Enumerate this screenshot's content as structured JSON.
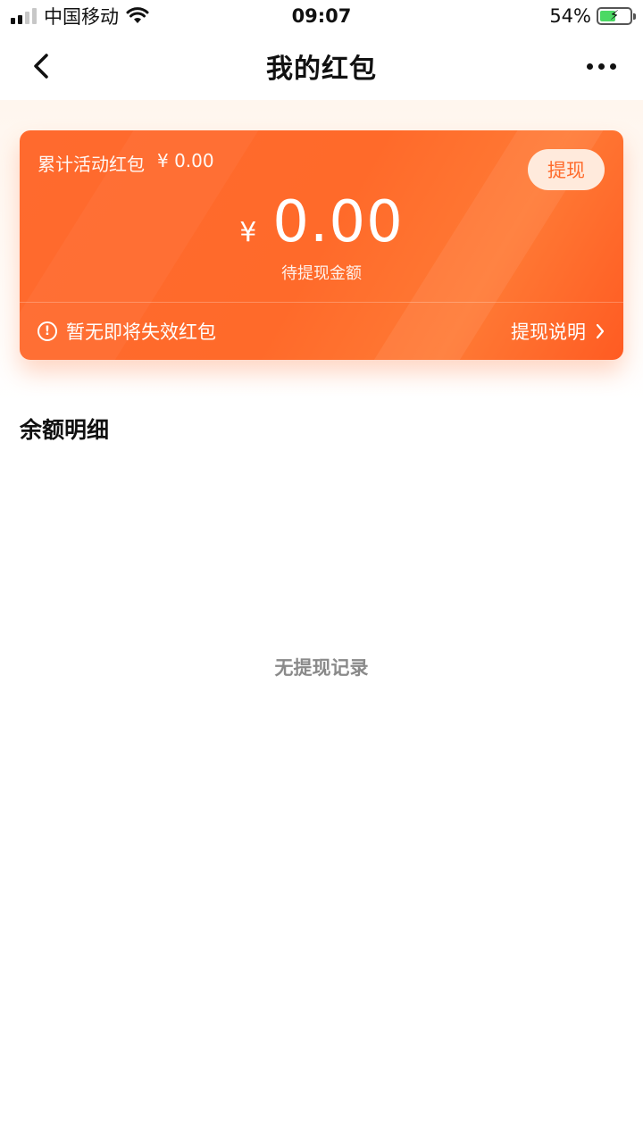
{
  "status_bar": {
    "carrier": "中国移动",
    "time": "09:07",
    "battery_percent": "54%",
    "battery_level": 0.54
  },
  "nav": {
    "title": "我的红包",
    "back_icon": "chevron-left-icon",
    "more_icon": "more-dots-icon"
  },
  "card": {
    "accumulated_label": "累计活动红包",
    "accumulated_value": "¥ 0.00",
    "withdraw_button": "提现",
    "currency_symbol": "¥",
    "amount": "0.00",
    "amount_label": "待提现金额",
    "expire_notice": "暂无即将失效红包",
    "explain_link": "提现说明",
    "accent_color": "#ff6a2a"
  },
  "section": {
    "title": "余额明细",
    "empty_text": "无提现记录"
  }
}
